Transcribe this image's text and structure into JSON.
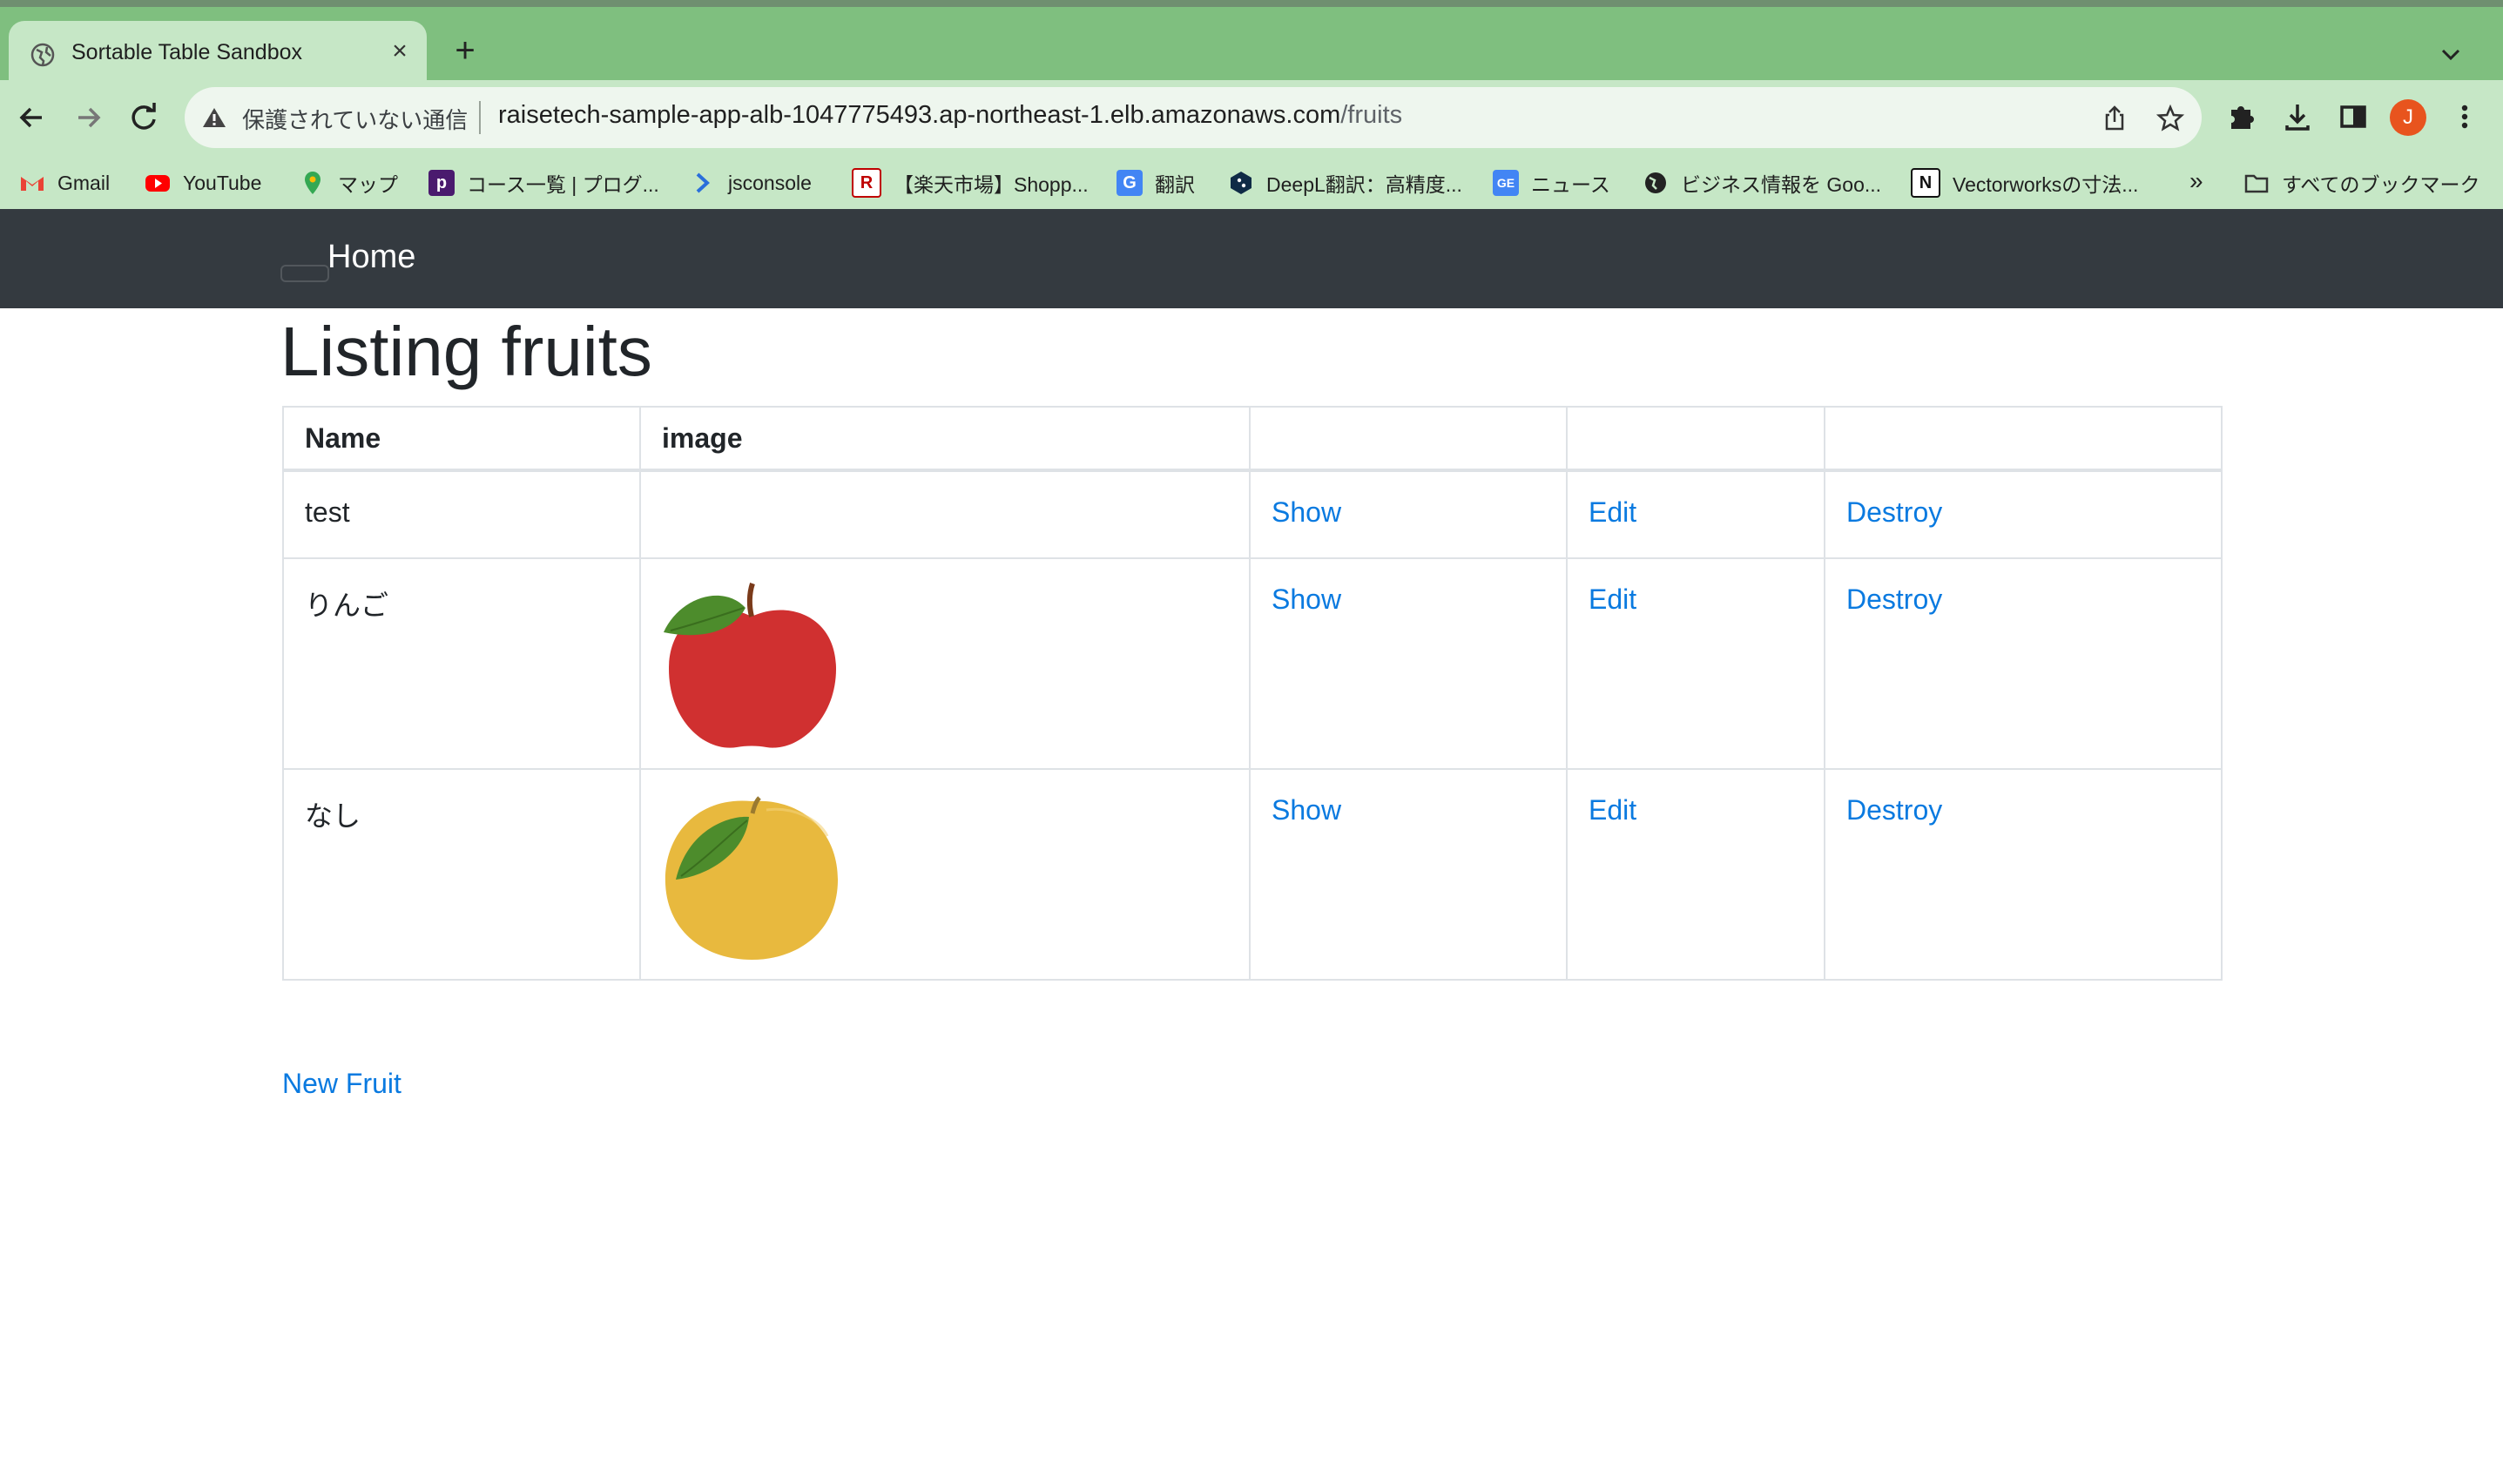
{
  "browser": {
    "tab_title": "Sortable Table Sandbox",
    "new_tab": "+",
    "tab_close": "×",
    "security_text": "保護されていない通信",
    "url_host": "raisetech-sample-app-alb-1047775493.ap-northeast-1.elb.amazonaws.com",
    "url_path": "/fruits",
    "profile_initial": "J",
    "bookmarks": [
      {
        "label": "Gmail",
        "icon": "gmail-icon"
      },
      {
        "label": "YouTube",
        "icon": "youtube-icon"
      },
      {
        "label": "マップ",
        "icon": "maps-icon"
      },
      {
        "label": "コース一覧 | プログ...",
        "icon": "course-icon"
      },
      {
        "label": "jsconsole",
        "icon": "chevron-icon"
      },
      {
        "label": "【楽天市場】Shopp...",
        "icon": "rakuten-icon"
      },
      {
        "label": "翻訳",
        "icon": "translate-icon"
      },
      {
        "label": "DeepL翻訳：高精度...",
        "icon": "deepl-icon"
      },
      {
        "label": "ニュース",
        "icon": "news-icon"
      },
      {
        "label": "ビジネス情報を Goo...",
        "icon": "globe-icon"
      },
      {
        "label": "Vectorworksの寸法...",
        "icon": "notion-icon"
      }
    ],
    "bookmarks_more": "»",
    "all_bookmarks": "すべてのブックマーク"
  },
  "navbar": {
    "brand": "Home"
  },
  "page": {
    "title": "Listing fruits",
    "columns": [
      "Name",
      "image",
      "",
      "",
      ""
    ],
    "rows": [
      {
        "name": "test",
        "image": null,
        "show": "Show",
        "edit": "Edit",
        "destroy": "Destroy"
      },
      {
        "name": "りんご",
        "image": "apple-image",
        "show": "Show",
        "edit": "Edit",
        "destroy": "Destroy"
      },
      {
        "name": "なし",
        "image": "pear-image",
        "show": "Show",
        "edit": "Edit",
        "destroy": "Destroy"
      }
    ],
    "new_link": "New Fruit"
  },
  "colors": {
    "tabstrip": "#7fbf7f",
    "toolbar": "#c6e7c6",
    "navbar": "#343a40",
    "link": "#0a7ae0",
    "apple": "#d03030",
    "pear": "#e8b93e",
    "leaf": "#4d8c2c"
  }
}
